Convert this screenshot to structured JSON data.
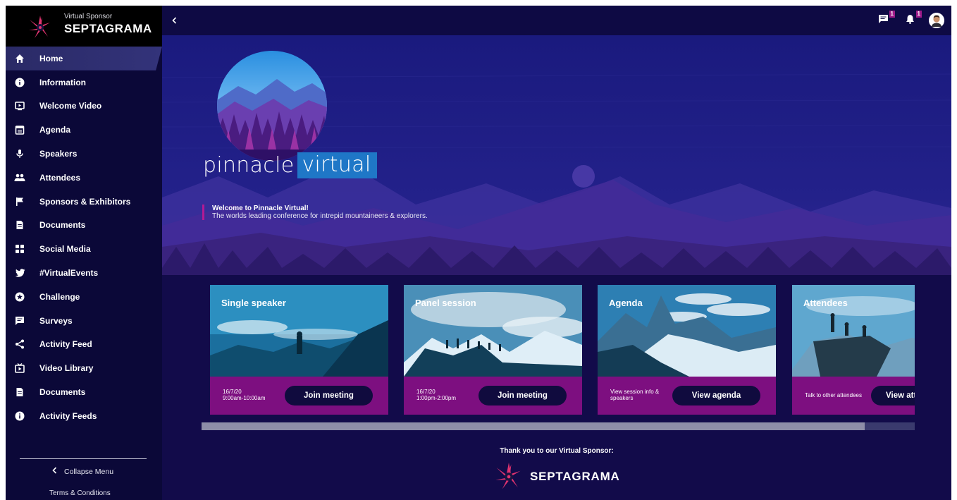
{
  "sponsor": {
    "label": "Virtual Sponsor",
    "name": "SEPTAGRAMA"
  },
  "nav": {
    "items": [
      {
        "label": "Home",
        "icon": "home-icon",
        "active": true
      },
      {
        "label": "Information",
        "icon": "info-icon"
      },
      {
        "label": "Welcome Video",
        "icon": "video-icon"
      },
      {
        "label": "Agenda",
        "icon": "calendar-icon"
      },
      {
        "label": "Speakers",
        "icon": "microphone-icon"
      },
      {
        "label": "Attendees",
        "icon": "people-icon"
      },
      {
        "label": "Sponsors & Exhibitors",
        "icon": "flag-icon"
      },
      {
        "label": "Documents",
        "icon": "document-icon"
      },
      {
        "label": "Social Media",
        "icon": "social-icon"
      },
      {
        "label": "#VirtualEvents",
        "icon": "twitter-icon"
      },
      {
        "label": "Challenge",
        "icon": "star-icon"
      },
      {
        "label": "Surveys",
        "icon": "survey-icon"
      },
      {
        "label": "Activity Feed",
        "icon": "share-icon"
      },
      {
        "label": "Video Library",
        "icon": "tv-icon"
      },
      {
        "label": "Documents",
        "icon": "document-icon"
      },
      {
        "label": "Activity Feeds",
        "icon": "info-icon"
      }
    ],
    "collapse_label": "Collapse Menu",
    "terms_label": "Terms & Conditions"
  },
  "topbar": {
    "chat_badge": "1",
    "notification_badge": "1"
  },
  "hero": {
    "logo_word1": "pinnacle",
    "logo_word2": "virtual",
    "welcome_title": "Welcome to Pinnacle Virtual!",
    "welcome_sub": "The worlds leading conference for intrepid mountaineers & explorers."
  },
  "cards": [
    {
      "title": "Single speaker",
      "info_line1": "16/7/20",
      "info_line2": "9:00am-10:00am",
      "button": "Join meeting"
    },
    {
      "title": "Panel session",
      "info_line1": "16/7/20",
      "info_line2": "1:00pm-2:00pm",
      "button": "Join meeting"
    },
    {
      "title": "Agenda",
      "info_line1": "View session info &",
      "info_line2": "speakers",
      "button": "View agenda"
    },
    {
      "title": "Attendees",
      "info_line1": "Talk to other attendees",
      "info_line2": "",
      "button": "View attendees"
    }
  ],
  "scroll": {
    "position_fraction": 0.93
  },
  "footer": {
    "thanks": "Thank you to our Virtual Sponsor:",
    "sponsor_name": "SEPTAGRAMA"
  },
  "colors": {
    "sidebar": "#0b0838",
    "accent_magenta": "#7d0f80",
    "logo_blue": "#1f77c7",
    "background": "#0f0a4a"
  }
}
